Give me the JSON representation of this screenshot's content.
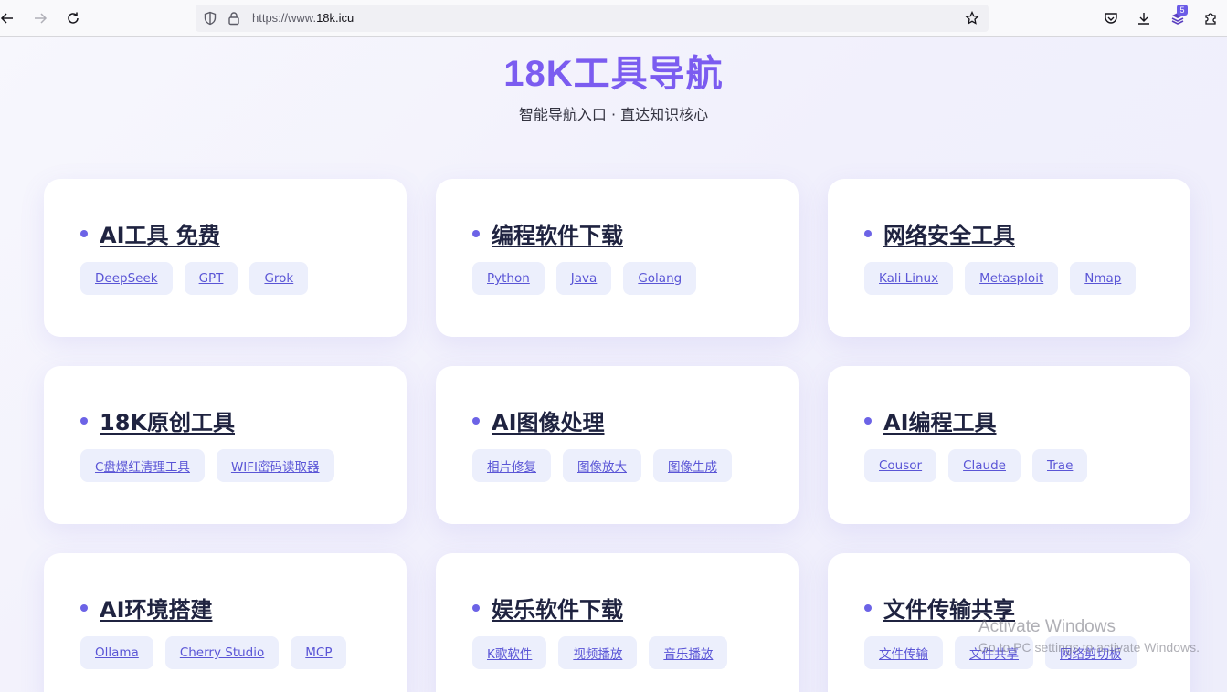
{
  "browser": {
    "url_prefix": "https://www.",
    "url_domain": "18k.icu",
    "extension_badge": "5"
  },
  "header": {
    "title": "18K工具导航",
    "subtitle": "智能导航入口 · 直达知识核心"
  },
  "cards": [
    {
      "title": "AI工具 免费",
      "tags": [
        "DeepSeek",
        "GPT",
        "Grok"
      ]
    },
    {
      "title": "编程软件下载",
      "tags": [
        "Python",
        "Java",
        "Golang"
      ]
    },
    {
      "title": "网络安全工具",
      "tags": [
        "Kali Linux",
        "Metasploit",
        "Nmap"
      ]
    },
    {
      "title": "18K原创工具",
      "tags": [
        "C盘爆红清理工具",
        "WIFI密码读取器"
      ]
    },
    {
      "title": "AI图像处理",
      "tags": [
        "相片修复",
        "图像放大",
        "图像生成"
      ]
    },
    {
      "title": "AI编程工具",
      "tags": [
        "Cousor",
        "Claude",
        "Trae"
      ]
    },
    {
      "title": "AI环境搭建",
      "tags": [
        "Ollama",
        "Cherry Studio",
        "MCP"
      ]
    },
    {
      "title": "娱乐软件下载",
      "tags": [
        "K歌软件",
        "视频播放",
        "音乐播放"
      ]
    },
    {
      "title": "文件传输共享",
      "tags": [
        "文件传输",
        "文件共享",
        "网络剪切板"
      ]
    }
  ],
  "watermark": {
    "line1": "Activate Windows",
    "line2": "Go to PC settings to activate Windows."
  },
  "colors": {
    "accent": "#7b5cf0",
    "tag_bg": "#eceffc",
    "tag_text": "#5a55d6",
    "title_text": "#1f2340"
  }
}
